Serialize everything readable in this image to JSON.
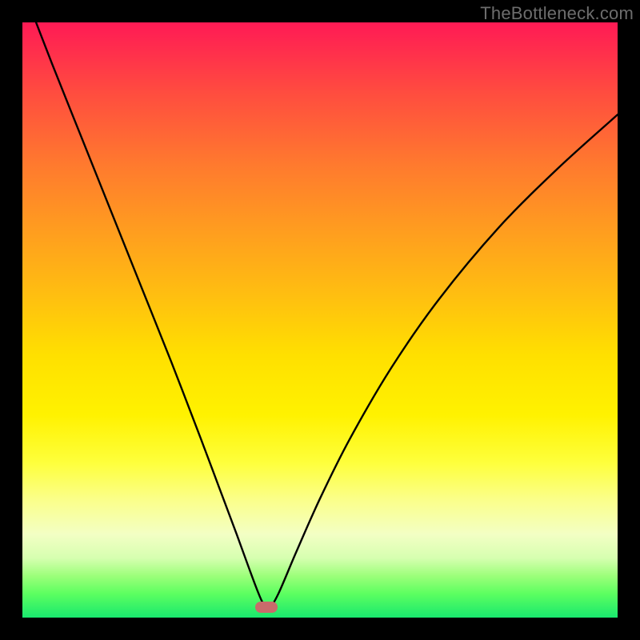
{
  "watermark": "TheBottleneck.com",
  "chart_data": {
    "type": "line",
    "title": "",
    "xlabel": "",
    "ylabel": "",
    "xlim": [
      0,
      100
    ],
    "ylim": [
      0,
      100
    ],
    "grid": false,
    "legend": false,
    "series": [
      {
        "name": "bottleneck-curve",
        "x": [
          0,
          5,
          10,
          15,
          20,
          25,
          30,
          33,
          36,
          38,
          39.5,
          40.5,
          41.5,
          43,
          46,
          50,
          55,
          62,
          70,
          80,
          90,
          100
        ],
        "y": [
          106,
          93,
          80.5,
          68,
          55.5,
          43,
          30,
          22,
          14,
          8.5,
          4.5,
          2.3,
          1.7,
          4,
          11,
          20,
          30,
          42,
          53.5,
          65.5,
          75.5,
          84.5
        ]
      }
    ],
    "annotations": [
      {
        "name": "min-marker",
        "x": 41,
        "y": 1.7
      }
    ],
    "background_gradient": {
      "top": "#ff1a55",
      "mid": "#ffe000",
      "bottom": "#19e86e"
    }
  }
}
